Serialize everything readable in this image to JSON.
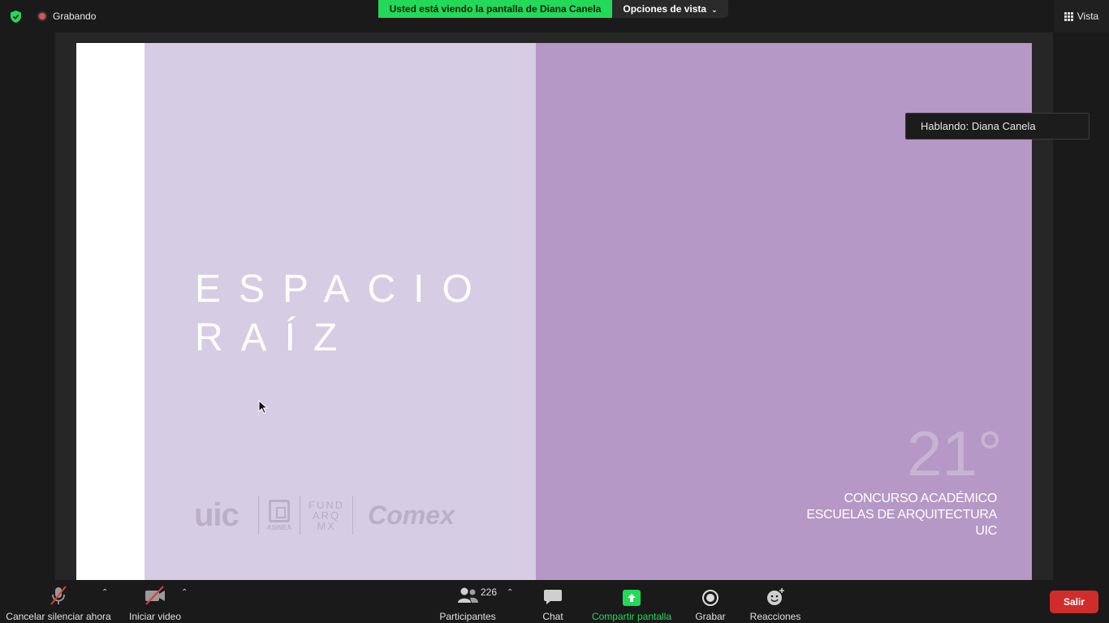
{
  "top": {
    "recording_label": "Grabando",
    "viewing_banner": "Usted está viendo la pantalla de Diana Canela",
    "view_options_label": "Opciones de vista",
    "vista_label": "Vista"
  },
  "slide": {
    "title_line1": "ESPACIO",
    "title_line2": "RAÍZ",
    "logo_uic": "uic",
    "logo_asinea": "ASINEA",
    "logo_fund_line1": "FUND",
    "logo_fund_line2": "ARQ",
    "logo_fund_line3": "MX",
    "logo_comex": "Comex",
    "contest_number": "21°",
    "contest_line1": "CONCURSO ACADÉMICO",
    "contest_line2": "ESCUELAS DE ARQUITECTURA",
    "contest_line3": "UIC"
  },
  "speaking_label": "Hablando: Diana Canela",
  "toolbar": {
    "mute_label": "Cancelar silenciar ahora",
    "video_label": "Iniciar video",
    "participants_count": "226",
    "participants_label": "Participantes",
    "chat_label": "Chat",
    "share_label": "Compartir pantalla",
    "record_label": "Grabar",
    "reactions_label": "Reacciones",
    "exit_label": "Salir"
  },
  "colors": {
    "accent_green": "#23d959",
    "exit_red": "#d12c2c",
    "slide_light": "#d6cce3",
    "slide_dark": "#b598c5"
  }
}
